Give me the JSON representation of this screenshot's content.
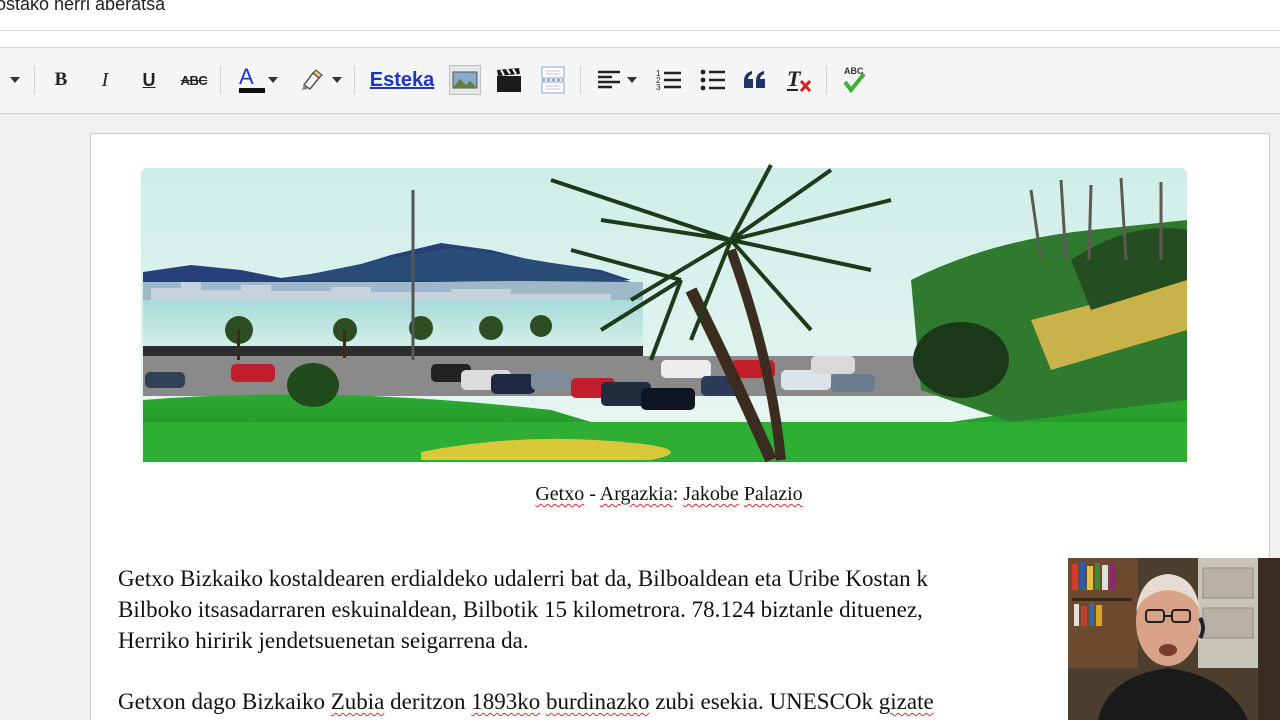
{
  "title": {
    "value": "ostako herri aberatsa"
  },
  "toolbar": {
    "bold_label": "B",
    "italic_label": "I",
    "underline_label": "U",
    "strike_label": "ABC",
    "text_color_label": "A",
    "link_label": "Esteka",
    "spellcheck_label": "ABC",
    "icons": [
      "dropdown-caret-icon",
      "bold-icon",
      "italic-icon",
      "underline-icon",
      "strikethrough-icon",
      "text-color-icon",
      "highlight-icon",
      "link-button",
      "image-icon",
      "video-icon",
      "insert-break-icon",
      "align-icon",
      "numbered-list-icon",
      "bullet-list-icon",
      "quote-icon",
      "remove-format-icon",
      "spellcheck-icon"
    ]
  },
  "content": {
    "caption": {
      "w1": "Getxo",
      "dash": " - ",
      "w2": "Argazkia",
      "colon": ": ",
      "w3": "Jakobe",
      "space": " ",
      "w4": "Palazio"
    },
    "paragraph1": {
      "line1": "Getxo Bizkaiko kostaldearen erdialdeko udalerri bat da, Bilboaldean eta Uribe Kostan k",
      "line2": "Bilboko itsasadarraren eskuinaldean, Bilbotik 15 kilometrora. 78.124 biztanle dituenez,",
      "line3": "Herriko hiririk jendetsuenetan seigarrena da."
    },
    "paragraph2": {
      "a": "Getxon dago Bizkaiko ",
      "b": "Zubia",
      "c": " deritzon ",
      "d": "1893ko",
      "e": " ",
      "f": "burdinazko",
      "g": " zubi esekia. UNESCOk ",
      "h": "gizate"
    }
  },
  "colors": {
    "link": "#1a36c8",
    "spellcheck_underline": "#e03030",
    "toolbar_bg": "#f5f5f5",
    "page_bg": "#f1f1f1"
  }
}
